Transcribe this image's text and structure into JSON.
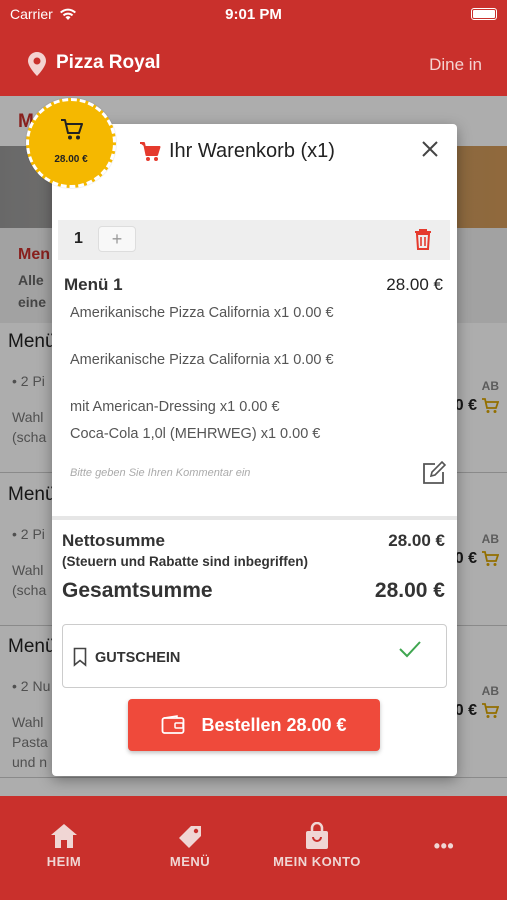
{
  "status": {
    "carrier": "Carrier",
    "time": "9:01 PM"
  },
  "header": {
    "restaurant": "Pizza Royal",
    "mode": "Dine in"
  },
  "background": {
    "menu_title": "M",
    "promo_title": "Men",
    "promo_line1": "Alle",
    "promo_line2": "eine",
    "cards": [
      {
        "title": "Menü",
        "l1": "• 2 Pi",
        "l2": "Wahl",
        "l3": "(scha",
        "ab": "AB",
        "price": "0 €"
      },
      {
        "title": "Menü",
        "l1": "• 2 Pi",
        "l2": "Wahl",
        "l3": "(scha",
        "ab": "AB",
        "price": "0 €"
      },
      {
        "title": "Menü",
        "l1": "• 2 Nu",
        "l2": "Wahl",
        "l3": "Pasta",
        "l4": "und n",
        "ab": "AB",
        "price": "0 €"
      }
    ]
  },
  "badge": {
    "price": "28.00 €",
    "icon": "cart-icon"
  },
  "cart": {
    "title": "Ihr Warenkorb (x1)",
    "quantity": "1",
    "plus": "+",
    "item": {
      "name": "Menü 1",
      "price": "28.00 €",
      "options": [
        "Amerikanische Pizza California x1 0.00 €",
        "Amerikanische Pizza California x1 0.00 €",
        "mit American-Dressing x1 0.00 €",
        "Coca-Cola 1,0l (MEHRWEG) x1 0.00 €"
      ]
    },
    "comment_placeholder": "Bitte geben Sie Ihren Kommentar ein",
    "net_label": "Nettosumme",
    "net_value": "28.00 €",
    "net_note": "(Steuern und Rabatte sind inbegriffen)",
    "total_label": "Gesamtsumme",
    "total_value": "28.00 €",
    "voucher_label": "GUTSCHEIN",
    "order_label": "Bestellen 28.00 €"
  },
  "tabs": [
    {
      "label": "HEIM",
      "icon": "home-icon"
    },
    {
      "label": "MENÜ",
      "icon": "tag-icon"
    },
    {
      "label": "MEIN KONTO",
      "icon": "bag-icon"
    },
    {
      "label": "•••",
      "icon": "more-icon"
    }
  ],
  "colors": {
    "primary": "#c9302c",
    "accent": "#ef4a3b",
    "badge": "#f5b800"
  }
}
